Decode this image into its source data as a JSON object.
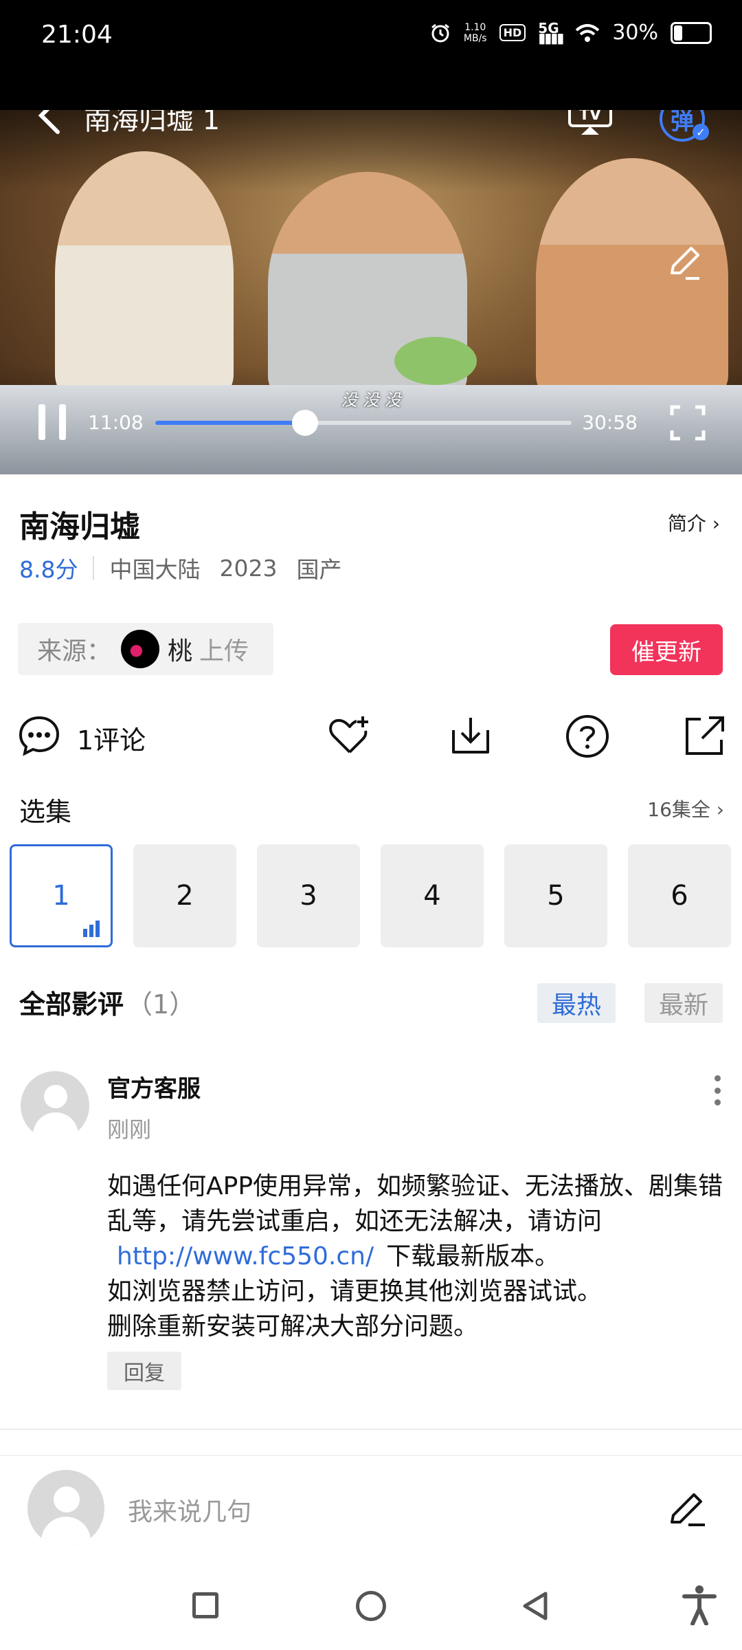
{
  "status_bar": {
    "time": "21:04",
    "net_speed_value": "1.10",
    "net_speed_unit": "MB/s",
    "hd": "HD",
    "signal": "5G",
    "battery": "30%",
    "battery_level": 0.3
  },
  "player": {
    "title": "南海归墟 1",
    "subtitle_text": "没 没 没",
    "current_time": "11:08",
    "total_time": "30:58",
    "progress": 0.36,
    "danmu_label": "弹",
    "tv_label": "TV"
  },
  "show": {
    "title": "南海归墟",
    "intro_label": "简介",
    "score": "8.8分",
    "region": "中国大陆",
    "year": "2023",
    "category": "国产"
  },
  "source": {
    "label": "来源：",
    "uploader": "桃",
    "uploaded": "上传",
    "urge_button": "催更新"
  },
  "actions": {
    "comment_count": "1评论"
  },
  "episodes": {
    "title": "选集",
    "all_label": "16集全",
    "items": [
      "1",
      "2",
      "3",
      "4",
      "5",
      "6"
    ],
    "active": "1"
  },
  "reviews": {
    "title": "全部影评",
    "count": "（1）",
    "tab_hot": "最热",
    "tab_new": "最新",
    "items": [
      {
        "author": "官方客服",
        "time": "刚刚",
        "line1": "如遇任何APP使用异常，如频繁验证、无法播放、剧集错乱等，请先尝试重启，如还无法解决，请访问",
        "link": "http://www.fc550.cn/",
        "line1_tail": "下载最新版本。",
        "line2": "如浏览器禁止访问，请更换其他浏览器试试。",
        "line3": "删除重新安装可解决大部分问题。",
        "reply_label": "回复"
      }
    ]
  },
  "input": {
    "placeholder": "我来说几句"
  },
  "colors": {
    "accent": "#2f6cd8",
    "urge": "#f2335a",
    "progress": "#3f7df7"
  }
}
